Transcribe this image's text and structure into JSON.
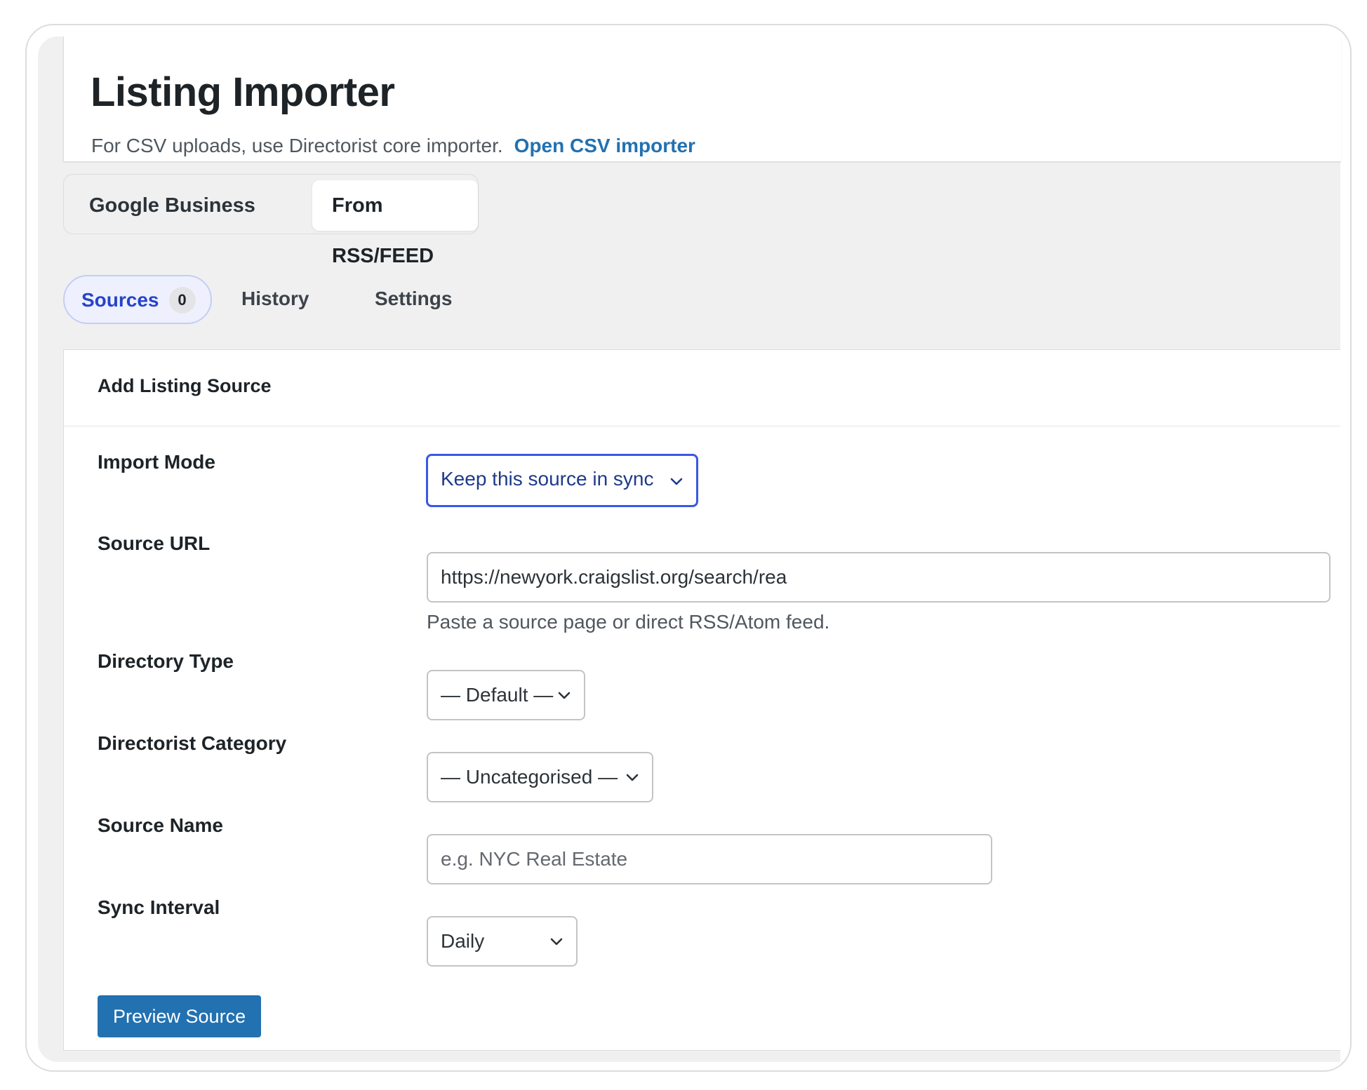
{
  "header": {
    "title": "Listing Importer",
    "subtitle": "For CSV uploads, use Directorist core importer.",
    "csv_link": "Open CSV importer"
  },
  "source_tabs": [
    {
      "label": "Google Business",
      "active": false
    },
    {
      "label": "From RSS/FEED",
      "active": true
    }
  ],
  "sub_tabs": {
    "sources": {
      "label": "Sources",
      "count": "0",
      "active": true
    },
    "history": {
      "label": "History"
    },
    "settings": {
      "label": "Settings"
    }
  },
  "form": {
    "title": "Add Listing Source",
    "import_mode": {
      "label": "Import Mode",
      "value": "Keep this source in sync"
    },
    "source_url": {
      "label": "Source URL",
      "value": "https://newyork.craigslist.org/search/rea",
      "help": "Paste a source page or direct RSS/Atom feed."
    },
    "directory_type": {
      "label": "Directory Type",
      "value": "— Default —"
    },
    "category": {
      "label": "Directorist Category",
      "value": "— Uncategorised —"
    },
    "source_name": {
      "label": "Source Name",
      "placeholder": "e.g. NYC Real Estate"
    },
    "sync_interval": {
      "label": "Sync Interval",
      "value": "Daily"
    },
    "preview_button": "Preview Source"
  },
  "colors": {
    "primary": "#2271b1",
    "active_tab": "#2743c9",
    "focus_border": "#3858e9"
  },
  "icons": {
    "chevron": "chevron-down-icon"
  }
}
